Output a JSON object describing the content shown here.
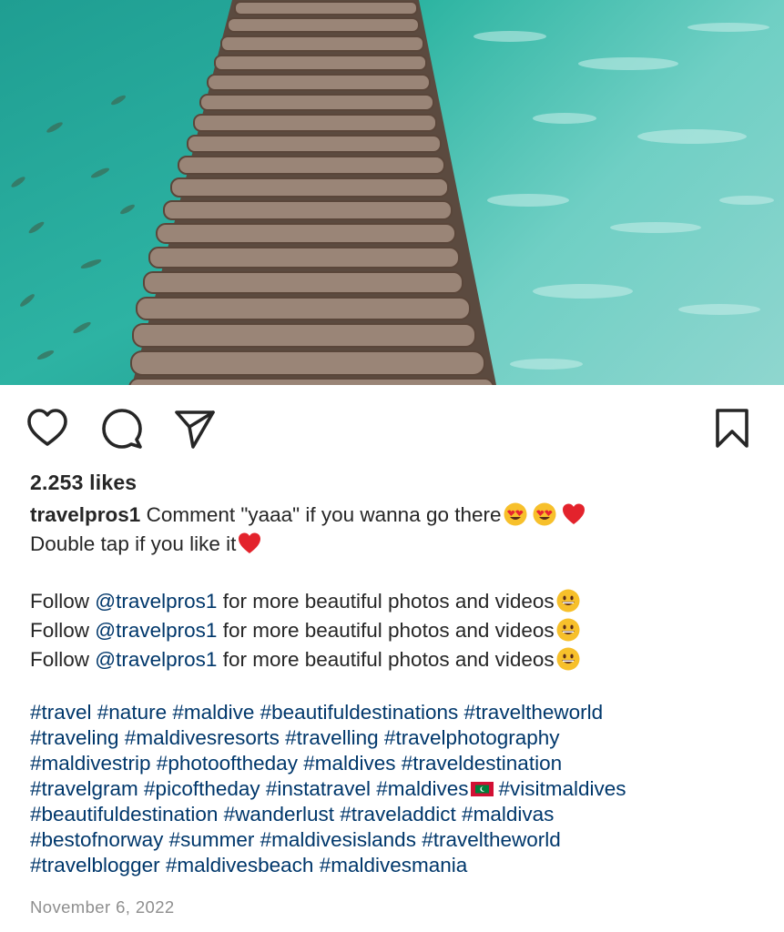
{
  "post": {
    "image_alt": "wooden boardwalk over turquoise water",
    "likes": "2.253 likes",
    "username": "travelpros1",
    "caption_line1": "Comment \"yaaa\" if you wanna go there",
    "caption_line2": "Double tap if you like it",
    "follow_prefix": "Follow ",
    "follow_mention": "@travelpros1",
    "follow_suffix": " for more beautiful photos and videos",
    "hashtag_lines": [
      "#travel #nature #maldive #beautifuldestinations #traveltheworld",
      "#traveling #maldivesresorts #travelling #travelphotography",
      "#maldivestrip #photooftheday #maldives #traveldestination",
      "#travelgram #picoftheday #instatravel #maldives",
      "#visitmaldives",
      "#beautifuldestination #wanderlust #traveladdict #maldivas",
      "#bestofnorway #summer #maldivesislands #traveltheworld",
      "#travelblogger #maldivesbeach #maldivesmania"
    ],
    "date": "November 6, 2022"
  },
  "icons": {
    "like": "heart-outline-icon",
    "comment": "speech-bubble-icon",
    "share": "paper-plane-icon",
    "save": "bookmark-icon",
    "emoji_heart_eyes": "heart-eyes-emoji",
    "emoji_red_heart": "red-heart-emoji",
    "emoji_grin": "grinning-emoji",
    "flag": "maldives-flag-emoji"
  },
  "colors": {
    "text": "#262626",
    "link": "#00376b",
    "muted": "#8e8e8e",
    "water": "#2fb0a3"
  }
}
